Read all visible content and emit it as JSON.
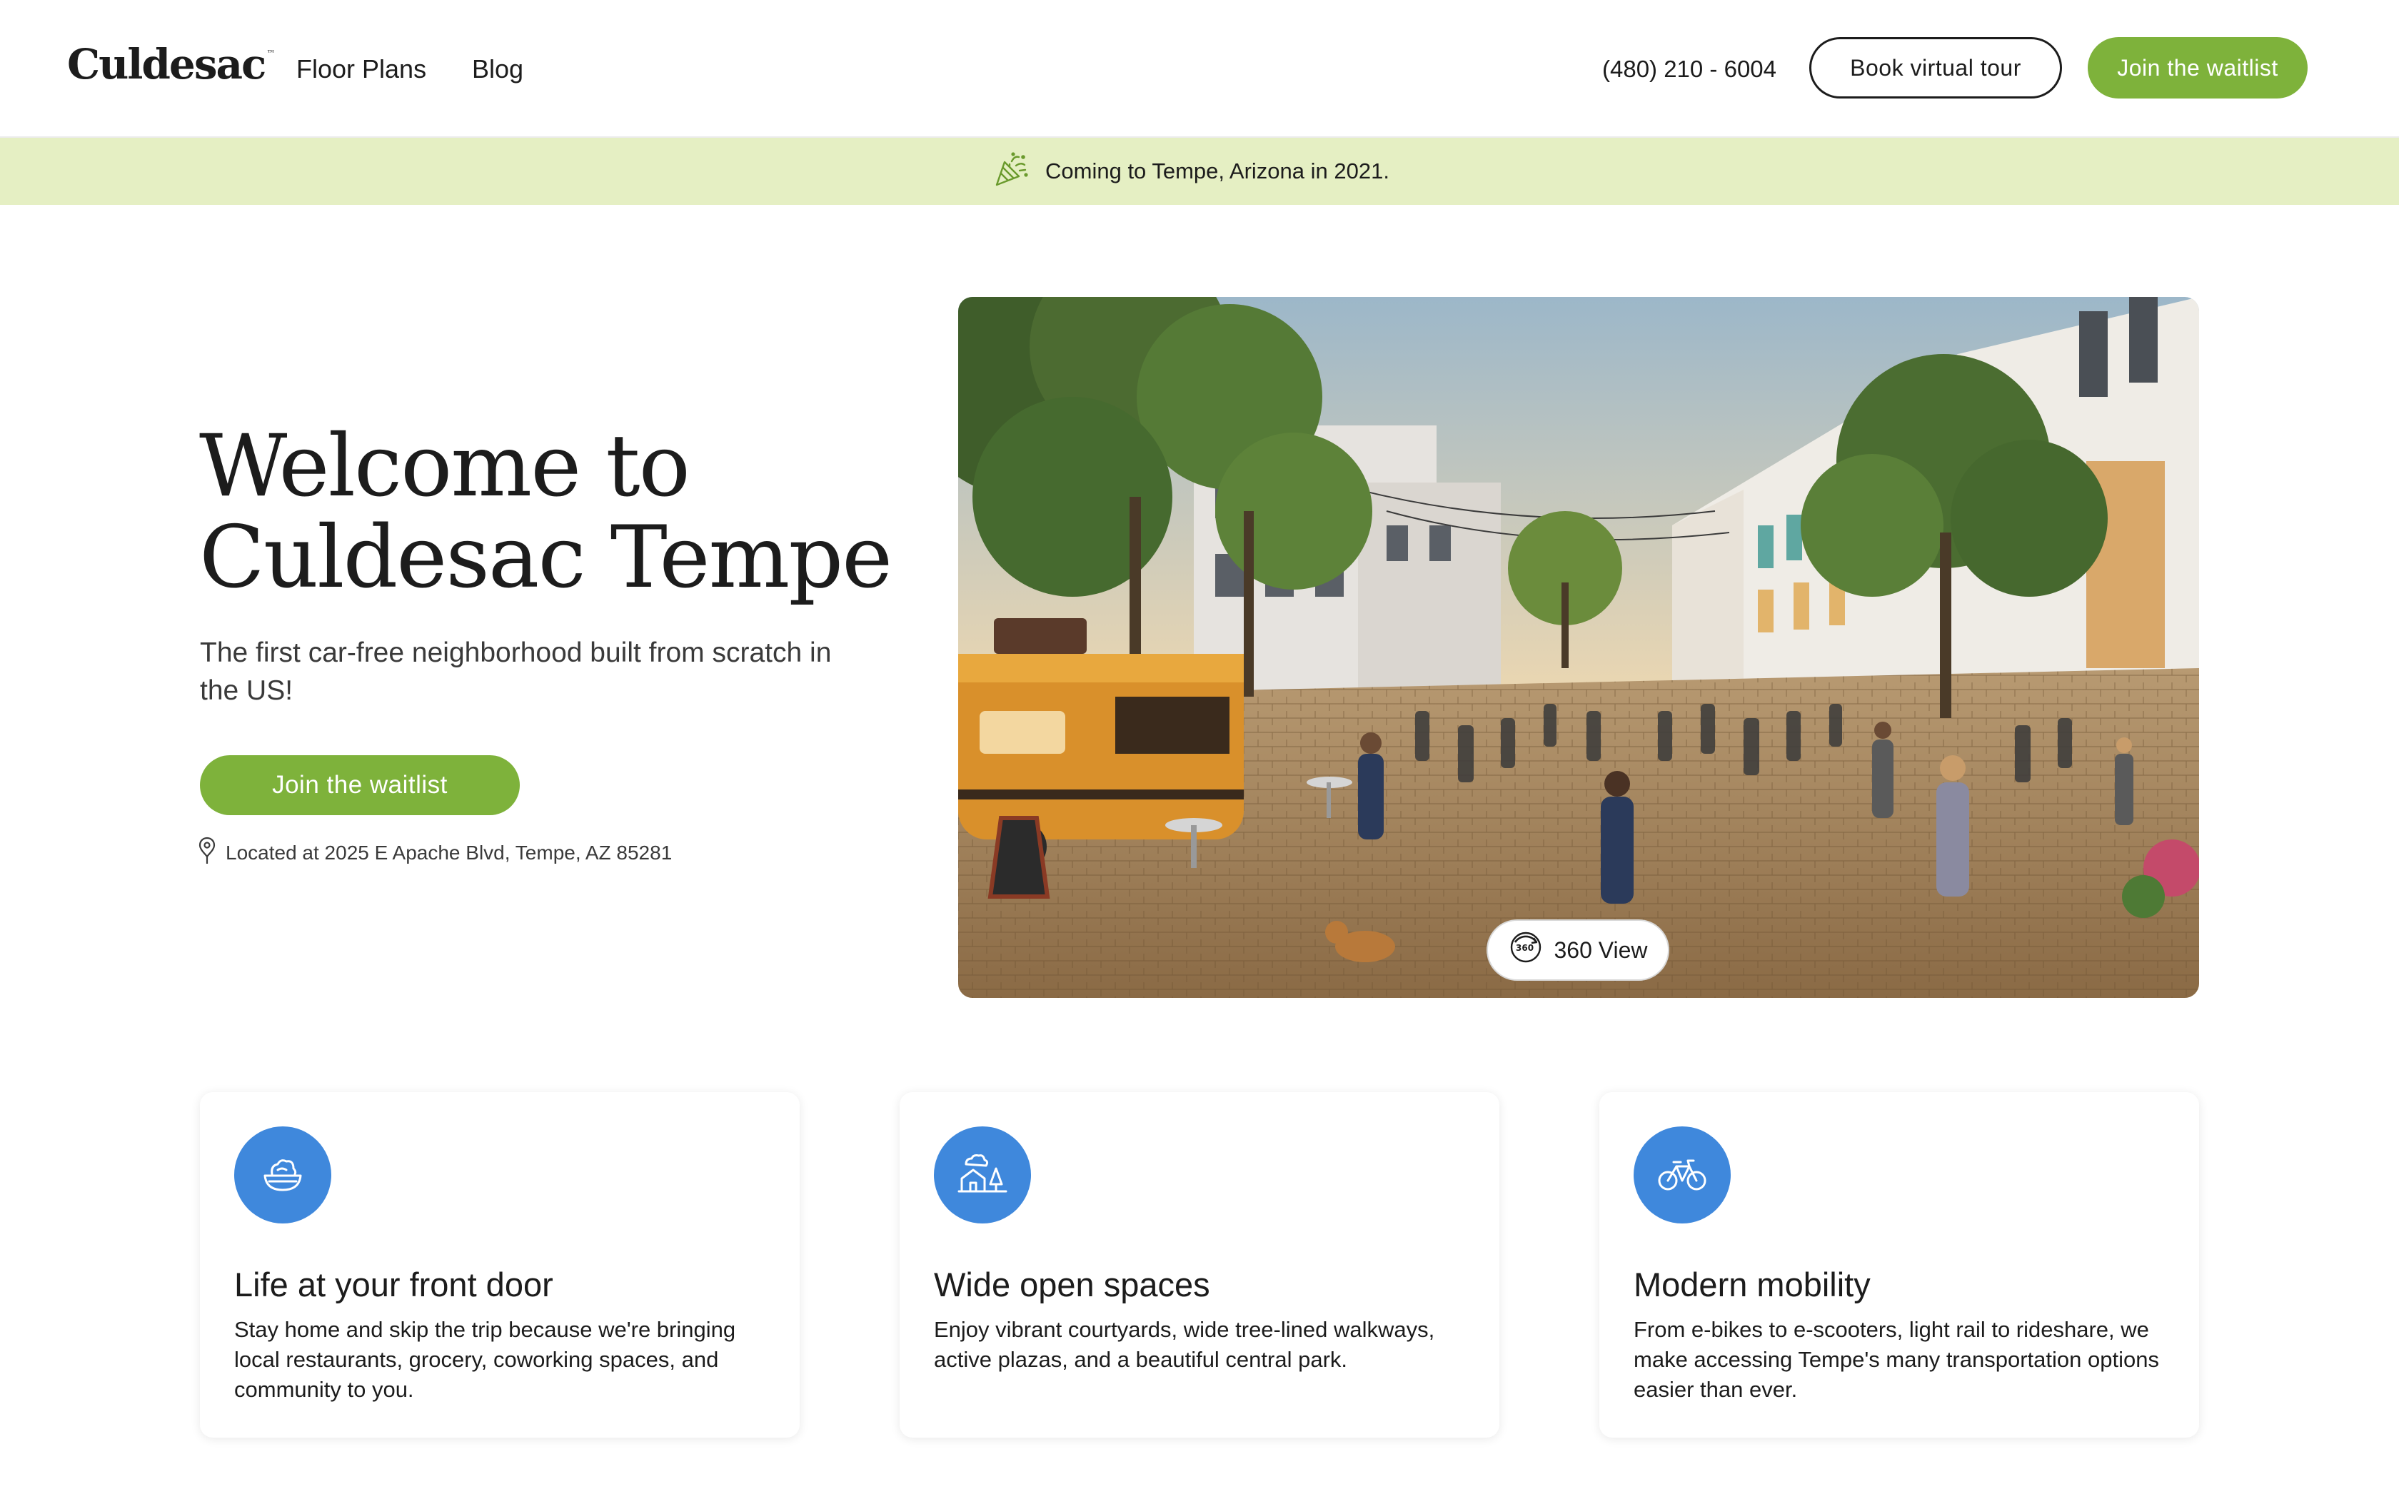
{
  "header": {
    "logo": "Culdesac",
    "logo_tm": "™",
    "nav": [
      {
        "label": "Floor Plans"
      },
      {
        "label": "Blog"
      }
    ],
    "phone": "(480) 210 - 6004",
    "tour_button": "Book virtual tour",
    "waitlist_button": "Join the waitlist"
  },
  "banner": {
    "icon": "party-popper-icon",
    "text": "Coming to Tempe, Arizona in 2021."
  },
  "hero": {
    "title_line1": "Welcome to",
    "title_line2": "Culdesac Tempe",
    "subtitle": "The first car-free neighborhood built from scratch in the US!",
    "cta": "Join the waitlist",
    "location_icon": "map-pin-icon",
    "location": "Located at 2025 E Apache Blvd, Tempe, AZ 85281",
    "image_button": "360 View",
    "image_button_icon": "rotate-360-icon"
  },
  "features": [
    {
      "icon": "food-bowl-icon",
      "title": "Life at your front door",
      "description": "Stay home and skip the trip because we're bringing local restaurants, grocery, coworking spaces, and community to you."
    },
    {
      "icon": "house-tree-icon",
      "title": "Wide open spaces",
      "description": "Enjoy vibrant courtyards, wide tree-lined walkways, active plazas, and a beautiful central park."
    },
    {
      "icon": "bicycle-icon",
      "title": "Modern mobility",
      "description": "From e-bikes to e-scooters, light rail to rideshare, we make accessing Tempe's many transportation options easier than ever."
    }
  ],
  "colors": {
    "accent_green": "#7eb23b",
    "banner_green": "#e5efc3",
    "icon_blue": "#3f88dc",
    "text": "#1c1c1c"
  }
}
